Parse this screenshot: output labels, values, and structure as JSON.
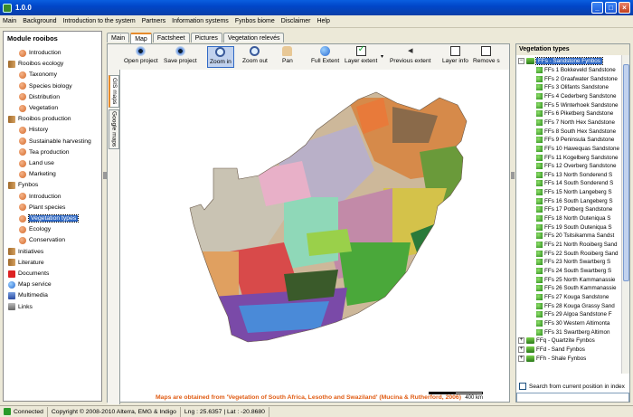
{
  "window": {
    "title": "1.0.0",
    "buttons": [
      "_",
      "□",
      "×"
    ]
  },
  "menu": [
    "Main",
    "Background",
    "Introduction to the system",
    "Partners",
    "Information systems",
    "Fynbos biome",
    "Disclaimer",
    "Help"
  ],
  "left": {
    "header": "Module rooibos",
    "items": [
      {
        "label": "Introduction",
        "level": 1,
        "icon": "dot"
      },
      {
        "label": "Rooibos ecology",
        "level": 0,
        "icon": "book"
      },
      {
        "label": "Taxonomy",
        "level": 1,
        "icon": "dot"
      },
      {
        "label": "Species biology",
        "level": 1,
        "icon": "dot"
      },
      {
        "label": "Distribution",
        "level": 1,
        "icon": "dot"
      },
      {
        "label": "Vegetation",
        "level": 1,
        "icon": "dot"
      },
      {
        "label": "Rooibos production",
        "level": 0,
        "icon": "book"
      },
      {
        "label": "History",
        "level": 1,
        "icon": "dot"
      },
      {
        "label": "Sustainable harvesting",
        "level": 1,
        "icon": "dot"
      },
      {
        "label": "Tea production",
        "level": 1,
        "icon": "dot"
      },
      {
        "label": "Land use",
        "level": 1,
        "icon": "dot"
      },
      {
        "label": "Marketing",
        "level": 1,
        "icon": "dot"
      },
      {
        "label": "Fynbos",
        "level": 0,
        "icon": "book"
      },
      {
        "label": "Introduction",
        "level": 1,
        "icon": "dot"
      },
      {
        "label": "Plant species",
        "level": 1,
        "icon": "dot"
      },
      {
        "label": "Vegetation types",
        "level": 1,
        "icon": "dot",
        "selected": true
      },
      {
        "label": "Ecology",
        "level": 1,
        "icon": "dot"
      },
      {
        "label": "Conservation",
        "level": 1,
        "icon": "dot"
      },
      {
        "label": "Initiatives",
        "level": 0,
        "icon": "book"
      },
      {
        "label": "Literature",
        "level": 0,
        "icon": "book"
      },
      {
        "label": "Documents",
        "level": 0,
        "icon": "pdf"
      },
      {
        "label": "Map service",
        "level": 0,
        "icon": "globe"
      },
      {
        "label": "Multimedia",
        "level": 0,
        "icon": "mm"
      },
      {
        "label": "Links",
        "level": 0,
        "icon": "lnk"
      }
    ]
  },
  "tabs": [
    "Main",
    "Map",
    "Factsheet",
    "Pictures",
    "Vegetation relevés"
  ],
  "active_tab": 1,
  "toolbar": [
    {
      "label": "Open project",
      "icon": "eye"
    },
    {
      "label": "Save project",
      "icon": "eye"
    },
    {
      "label": "Zoom in",
      "icon": "zin",
      "active": true
    },
    {
      "label": "Zoom out",
      "icon": "zout"
    },
    {
      "label": "Pan",
      "icon": "hand"
    },
    {
      "label": "Full Extent",
      "icon": "globe"
    },
    {
      "label": "Layer extent",
      "icon": "check"
    },
    {
      "label": "Previous extent",
      "icon": "arrow"
    },
    {
      "label": "Layer info",
      "icon": "info"
    },
    {
      "label": "Remove s",
      "icon": "rm"
    }
  ],
  "side_tabs": [
    "GIS maps",
    "Google maps"
  ],
  "map": {
    "scale_label": "400 km",
    "credit": "Maps are obtained from 'Vegetation of South Africa, Lesotho and Swaziland' (Mucina & Rutherford, 2006)"
  },
  "right": {
    "header": "Vegetation types",
    "group_selected": "FFs - Sandstone Fynbos",
    "items": [
      "FFs 1  Bokkeveld Sandstone",
      "FFs 2  Graafwater Sandstone",
      "FFs 3  Olifants Sandstone",
      "FFs 4  Cederberg Sandstone",
      "FFs 5  Winterhoek Sandstone",
      "FFs 6  Piketberg Sandstone",
      "FFs 7  North Hex Sandstone",
      "FFs 8  South Hex Sandstone",
      "FFs 9  Peninsula Sandstone",
      "FFs 10  Hawequas Sandstone",
      "FFs 11  Kogelberg Sandstone",
      "FFs 12  Overberg Sandstone",
      "FFs 13  North Sonderend S",
      "FFs 14  South Sonderend S",
      "FFs 15  North Langeberg S",
      "FFs 16  South Langeberg S",
      "FFs 17  Potberg Sandstone",
      "FFs 18  North Outeniqua S",
      "FFs 19  South Outeniqua S",
      "FFs 20  Tsitsikamma Sandst",
      "FFs 21  North Rooiberg Sand",
      "FFs 22  South Rooiberg Sand",
      "FFs 23  North Swartberg S",
      "FFs 24  South Swartberg S",
      "FFs 25  North Kammanassie",
      "FFs 26  South Kammanassie",
      "FFs 27  Kouga Sandstone",
      "FFs 28  Kouga Grassy Sand",
      "FFs 29  Algoa Sandstone F",
      "FFs 30  Western Altimonta",
      "FFs 31  Swartberg Altimon"
    ],
    "groups_after": [
      "FFq - Quartzite Fynbos",
      "FFd - Sand Fynbos",
      "FFh - Shale Fynbos"
    ],
    "search_label": "Search from current position in index"
  },
  "status": {
    "connected": "Connected",
    "copyright": "Copyright © 2008-2010 Alterra, EMG & Indigo",
    "coords": "Lng : 25.6357 | Lat : -20.8680"
  }
}
